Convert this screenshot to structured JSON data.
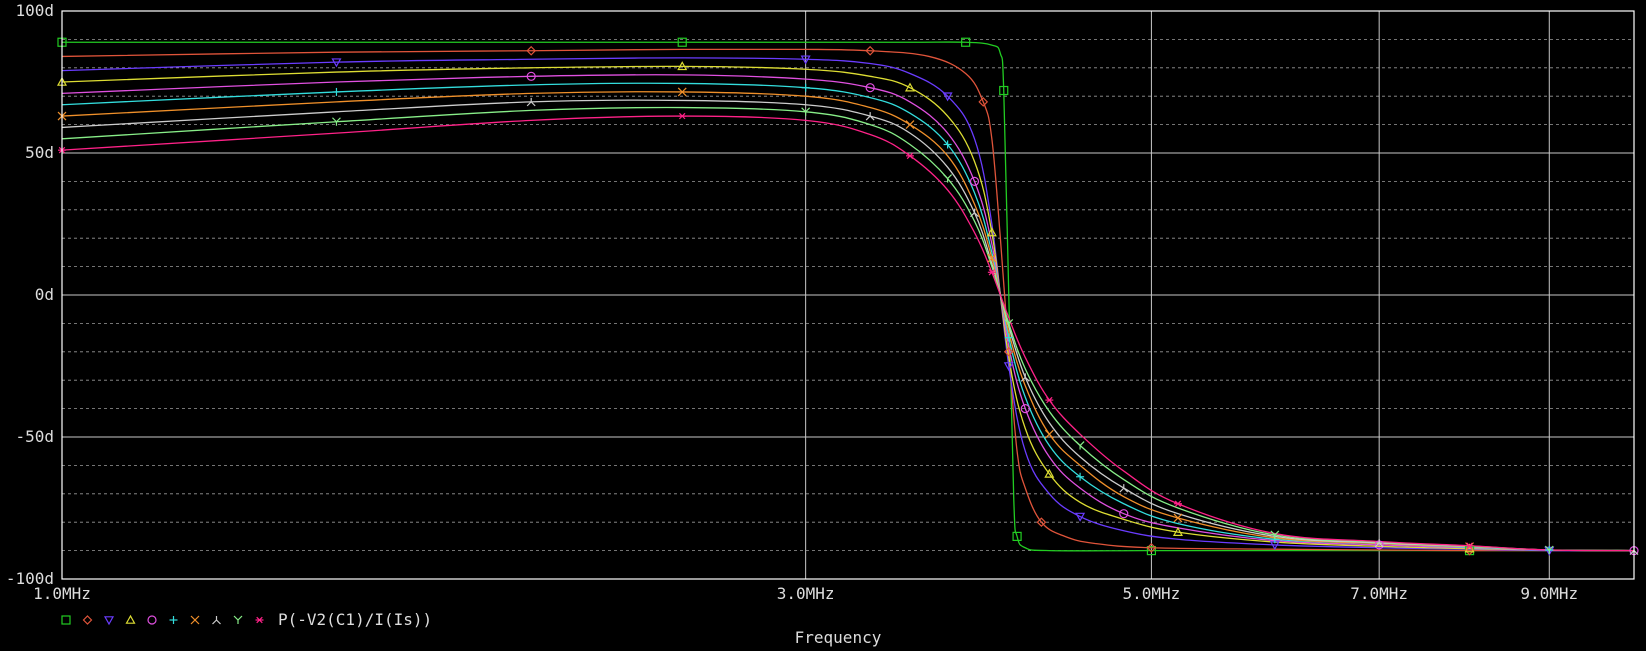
{
  "chart_data": {
    "type": "line",
    "title": "",
    "xlabel": "Frequency",
    "ylabel": "",
    "x_scale": "log",
    "xlim_mhz": [
      1.0,
      10.2
    ],
    "ylim": [
      -100,
      100
    ],
    "x_ticks": [
      {
        "value": 1.0,
        "label": "1.0MHz"
      },
      {
        "value": 3.0,
        "label": "3.0MHz"
      },
      {
        "value": 5.0,
        "label": "5.0MHz"
      },
      {
        "value": 7.0,
        "label": "7.0MHz"
      },
      {
        "value": 9.0,
        "label": "9.0MHz"
      }
    ],
    "y_ticks": [
      {
        "value": 100,
        "label": "100d"
      },
      {
        "value": 50,
        "label": "50d"
      },
      {
        "value": 0,
        "label": "0d"
      },
      {
        "value": -50,
        "label": "-50d"
      },
      {
        "value": -100,
        "label": "-100d"
      }
    ],
    "grid": true,
    "legend_position": "bottom-left",
    "legend_label": "P(-V2(C1)/I(Is))",
    "colors": {
      "background": "#000000",
      "axes": "#ffffff",
      "major_grid": "#c8c8c8",
      "minor_grid": "#9a9a9a",
      "text": "#dddddd"
    },
    "series": [
      {
        "color": "#22cc22",
        "marker": "square",
        "x": [
          1.0,
          1.5,
          2.0,
          2.5,
          3.0,
          3.5,
          3.8,
          3.95,
          4.0,
          4.02,
          4.05,
          4.08,
          4.1,
          4.15,
          4.3,
          5.0,
          6.0,
          7.0,
          8.0,
          9.0,
          10.2
        ],
        "y": [
          89,
          89,
          89,
          89,
          89,
          89,
          89,
          88,
          85,
          72,
          0,
          -72,
          -85,
          -89,
          -90,
          -90,
          -90,
          -90,
          -90,
          -90,
          -90
        ]
      },
      {
        "color": "#e0543a",
        "marker": "diamond",
        "x": [
          1.0,
          1.5,
          2.0,
          2.5,
          3.0,
          3.3,
          3.6,
          3.8,
          3.9,
          3.95,
          4.0,
          4.05,
          4.1,
          4.15,
          4.25,
          4.4,
          4.6,
          5.0,
          6.0,
          7.0,
          8.0,
          9.0,
          10.2
        ],
        "y": [
          84,
          85.5,
          86,
          86.5,
          86.5,
          86,
          84,
          78,
          68,
          55,
          20,
          -20,
          -55,
          -68,
          -80,
          -85,
          -87.5,
          -89,
          -89.5,
          -89.8,
          -90,
          -90,
          -90
        ]
      },
      {
        "color": "#6a3cff",
        "marker": "triangle-down",
        "x": [
          1.0,
          1.5,
          2.0,
          2.5,
          3.0,
          3.3,
          3.5,
          3.7,
          3.85,
          3.95,
          4.05,
          4.15,
          4.3,
          4.5,
          4.8,
          5.2,
          6.0,
          7.0,
          8.0,
          9.0,
          10.2
        ],
        "y": [
          79,
          82,
          83,
          83.5,
          83,
          81.5,
          78,
          70,
          55,
          25,
          -25,
          -55,
          -70,
          -78,
          -83,
          -86,
          -88,
          -89,
          -89.5,
          -90,
          -90
        ]
      },
      {
        "color": "#dddd33",
        "marker": "triangle-up",
        "x": [
          1.0,
          1.5,
          2.0,
          2.5,
          3.0,
          3.3,
          3.5,
          3.7,
          3.85,
          3.95,
          4.05,
          4.15,
          4.3,
          4.5,
          4.8,
          5.2,
          6.0,
          7.0,
          8.0,
          9.0,
          10.2
        ],
        "y": [
          75,
          78.5,
          80,
          80.5,
          79.5,
          77,
          73,
          63,
          47,
          22,
          -22,
          -47,
          -63,
          -73,
          -79,
          -83.5,
          -87,
          -88.5,
          -89.3,
          -89.8,
          -90
        ]
      },
      {
        "color": "#e050e0",
        "marker": "circle",
        "x": [
          1.0,
          1.5,
          2.0,
          2.5,
          3.0,
          3.3,
          3.5,
          3.7,
          3.85,
          3.95,
          4.05,
          4.15,
          4.3,
          4.5,
          4.8,
          5.2,
          6.0,
          7.0,
          8.0,
          9.0,
          10.2
        ],
        "y": [
          71,
          75,
          77,
          77.5,
          76,
          73,
          68,
          57,
          40,
          18,
          -18,
          -40,
          -57,
          -68,
          -77,
          -82,
          -86.5,
          -88,
          -89,
          -89.8,
          -90
        ]
      },
      {
        "color": "#33dddd",
        "marker": "plus",
        "x": [
          1.0,
          1.5,
          2.0,
          2.5,
          3.0,
          3.3,
          3.5,
          3.7,
          3.85,
          3.95,
          4.05,
          4.15,
          4.3,
          4.5,
          4.8,
          5.2,
          6.0,
          7.0,
          8.0,
          9.0,
          10.2
        ],
        "y": [
          67,
          71.5,
          74,
          74.5,
          73,
          69.5,
          64,
          53,
          36,
          15,
          -15,
          -36,
          -53,
          -64,
          -73.5,
          -80.5,
          -86,
          -87.5,
          -88.8,
          -89.8,
          -90
        ]
      },
      {
        "color": "#f0902a",
        "marker": "x",
        "x": [
          1.0,
          1.5,
          2.0,
          2.5,
          3.0,
          3.3,
          3.5,
          3.7,
          3.85,
          3.95,
          4.05,
          4.15,
          4.3,
          4.5,
          4.8,
          5.2,
          6.0,
          7.0,
          8.0,
          9.0,
          10.2
        ],
        "y": [
          63,
          68,
          71,
          71.5,
          70,
          66,
          60,
          49,
          32,
          13,
          -13,
          -32,
          -49,
          -60,
          -71,
          -78.5,
          -85.5,
          -87.5,
          -88.6,
          -89.8,
          -90
        ]
      },
      {
        "color": "#cccccc",
        "marker": "tri-up",
        "x": [
          1.0,
          1.5,
          2.0,
          2.5,
          3.0,
          3.3,
          3.5,
          3.7,
          3.85,
          3.95,
          4.05,
          4.15,
          4.3,
          4.5,
          4.8,
          5.2,
          6.0,
          7.0,
          8.0,
          9.0,
          10.2
        ],
        "y": [
          59,
          64.5,
          68,
          68.5,
          67,
          63,
          57,
          45,
          29,
          11,
          -11,
          -29,
          -45,
          -57,
          -68,
          -77,
          -85,
          -87.3,
          -88.5,
          -89.8,
          -90
        ]
      },
      {
        "color": "#88ee88",
        "marker": "y",
        "x": [
          1.0,
          1.5,
          2.0,
          2.5,
          3.0,
          3.3,
          3.5,
          3.7,
          3.85,
          3.95,
          4.05,
          4.15,
          4.3,
          4.5,
          4.8,
          5.2,
          6.0,
          7.0,
          8.0,
          9.0,
          10.2
        ],
        "y": [
          55,
          61,
          65,
          66,
          64.5,
          60,
          53,
          41,
          26,
          10,
          -10,
          -26,
          -41,
          -53,
          -65,
          -75,
          -84.5,
          -87,
          -88.4,
          -89.8,
          -90
        ]
      },
      {
        "color": "#ff2288",
        "marker": "asterisk",
        "x": [
          1.0,
          1.5,
          2.0,
          2.5,
          3.0,
          3.3,
          3.5,
          3.7,
          3.85,
          3.95,
          4.05,
          4.15,
          4.3,
          4.5,
          4.8,
          5.2,
          6.0,
          7.0,
          8.0,
          9.0,
          10.2
        ],
        "y": [
          51,
          57,
          61.5,
          63,
          61.5,
          56.5,
          49,
          37,
          22,
          8,
          -8,
          -22,
          -37,
          -49,
          -62,
          -73.5,
          -84,
          -86.8,
          -88.3,
          -89.8,
          -90
        ]
      }
    ]
  }
}
